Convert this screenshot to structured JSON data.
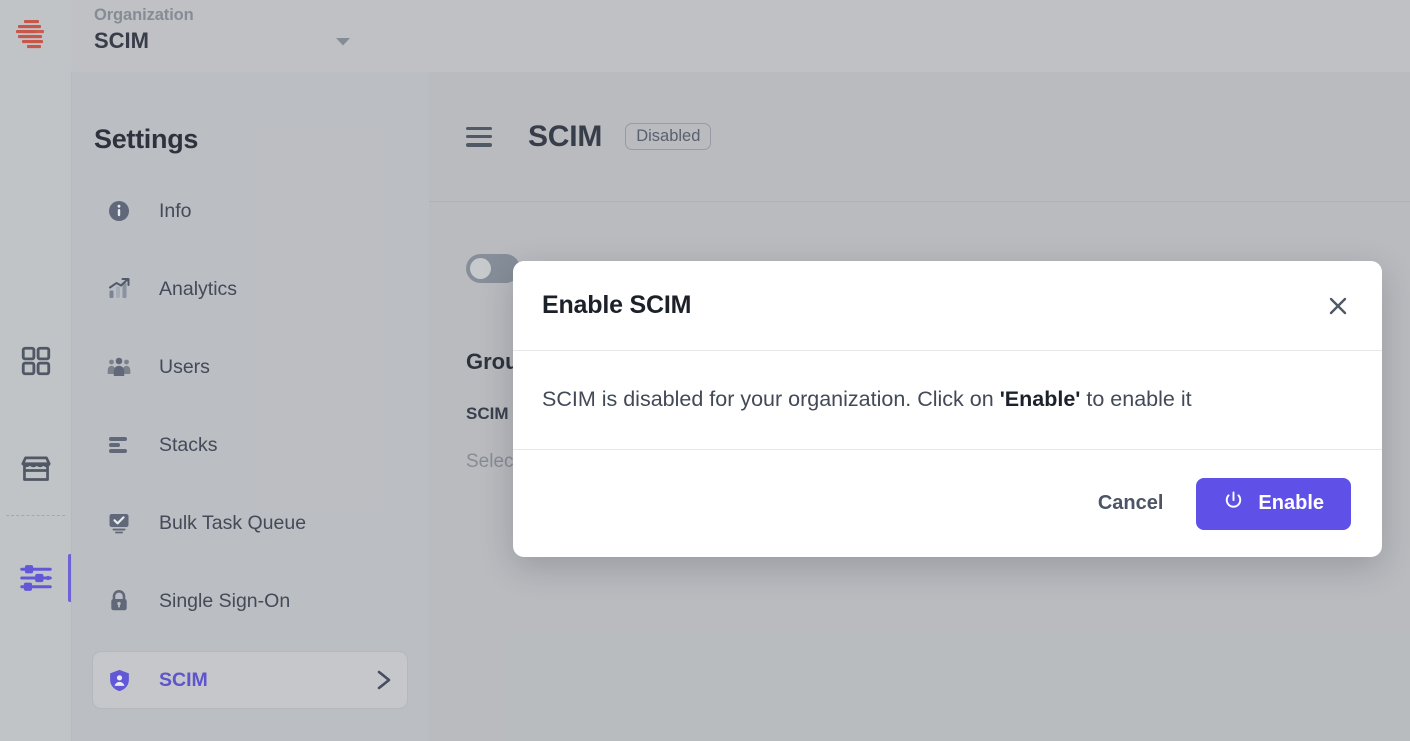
{
  "colors": {
    "accent": "#5f51e8",
    "sidebar_active_text": "#5b4ddb",
    "logo_red": "#d9503f",
    "page_bg": "#cdcfd2",
    "modal_bg": "#ffffff"
  },
  "topbar": {
    "logo_name": "brand-logo",
    "org_label": "Organization",
    "org_value": "SCIM",
    "org_dropdown_icon": "chevron-down-icon"
  },
  "rail": {
    "items": [
      {
        "name": "apps-grid",
        "icon": "grid-icon",
        "active": false
      },
      {
        "name": "marketplace",
        "icon": "store-icon",
        "active": false
      },
      {
        "name": "settings",
        "icon": "sliders-icon",
        "active": true
      }
    ]
  },
  "sidebar": {
    "title": "Settings",
    "items": [
      {
        "label": "Info",
        "icon": "info-circle-icon",
        "active": false
      },
      {
        "label": "Analytics",
        "icon": "chart-trend-icon",
        "active": false
      },
      {
        "label": "Users",
        "icon": "users-group-icon",
        "active": false
      },
      {
        "label": "Stacks",
        "icon": "stacks-icon",
        "active": false
      },
      {
        "label": "Bulk Task Queue",
        "icon": "monitor-check-icon",
        "active": false
      },
      {
        "label": "Single Sign-On",
        "icon": "lock-icon",
        "active": false
      },
      {
        "label": "SCIM",
        "icon": "shield-person-icon",
        "active": true,
        "chevron": "chevron-right-icon"
      }
    ]
  },
  "main": {
    "menu_icon": "hamburger-menu-icon",
    "title": "SCIM",
    "status_badge": "Disabled",
    "toggle": {
      "name": "scim-enable-toggle",
      "state": "off"
    },
    "section_heading": "Group",
    "field_label": "SCIM",
    "field_placeholder": "Select"
  },
  "modal": {
    "title": "Enable SCIM",
    "close_icon": "close-icon",
    "message_prefix": "SCIM is disabled for your organization. Click on ",
    "message_bold": "'Enable'",
    "message_suffix": " to enable it",
    "cancel_label": "Cancel",
    "enable_label": "Enable",
    "enable_icon": "power-icon"
  }
}
